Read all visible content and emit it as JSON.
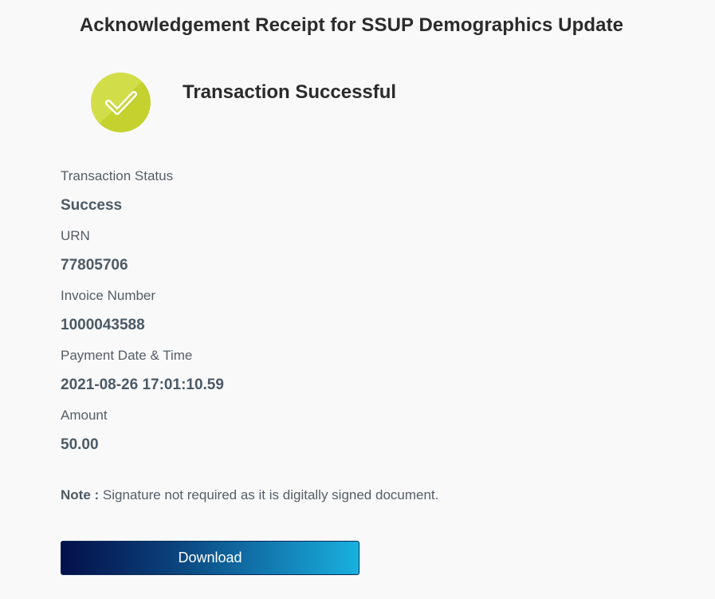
{
  "header": {
    "title": "Acknowledgement Receipt for SSUP Demographics Update"
  },
  "status_banner": {
    "icon": "check-circle-icon",
    "heading": "Transaction Successful",
    "icon_color": "#c4d12e"
  },
  "details": {
    "fields": [
      {
        "label": "Transaction Status",
        "value": "Success"
      },
      {
        "label": "URN",
        "value": "77805706"
      },
      {
        "label": "Invoice Number",
        "value": "1000043588"
      },
      {
        "label": "Payment Date & Time",
        "value": "2021-08-26 17:01:10.59"
      },
      {
        "label": "Amount",
        "value": "50.00"
      }
    ]
  },
  "note": {
    "label": "Note :",
    "text": "Signature not required as it is digitally signed document."
  },
  "actions": {
    "download_label": "Download"
  },
  "colors": {
    "background": "#f9f9fa",
    "title_text": "#2b2b2b",
    "label_text": "#555d66",
    "value_text": "#4c5a66",
    "button_gradient_start": "#04104a",
    "button_gradient_end": "#19b1de"
  }
}
